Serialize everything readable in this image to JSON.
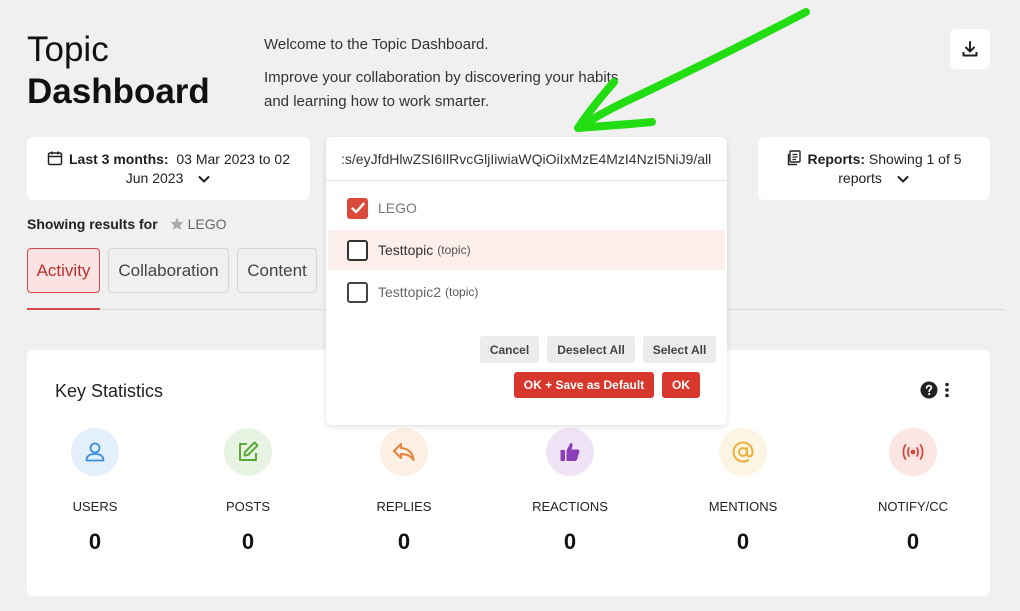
{
  "header": {
    "title_line1": "Topic",
    "title_line2": "Dashboard",
    "welcome_line1": "Welcome to the Topic Dashboard.",
    "welcome_line2": "Improve your collaboration by discovering your habits and learning how to work smarter."
  },
  "date_filter": {
    "label": "Last 3 months:",
    "range": "03 Mar 2023 to 02 Jun 2023"
  },
  "reports_filter": {
    "label": "Reports:",
    "value": "Showing 1 of 5 reports"
  },
  "topic_dropdown": {
    "search_value": ":s/eyJfdHlwZSI6IlRvcGljIiwiaWQiOiIxMzE4MzI4NzI5NiJ9/all",
    "options": [
      {
        "label": "LEGO",
        "type": "",
        "checked": true
      },
      {
        "label": "Testtopic",
        "type": "(topic)",
        "checked": false
      },
      {
        "label": "Testtopic2",
        "type": "(topic)",
        "checked": false
      }
    ],
    "cancel_label": "Cancel",
    "deselect_all_label": "Deselect All",
    "select_all_label": "Select All",
    "ok_save_default_label": "OK + Save as Default",
    "ok_label": "OK"
  },
  "showing_results": {
    "label": "Showing results for",
    "topic": "LEGO"
  },
  "tabs": [
    {
      "label": "Activity",
      "active": true
    },
    {
      "label": "Collaboration",
      "active": false
    },
    {
      "label": "Content",
      "active": false
    }
  ],
  "key_statistics": {
    "title": "Key Statistics",
    "items": [
      {
        "label": "USERS",
        "value": "0",
        "icon": "user-icon",
        "color": "#3b8fd9",
        "bg": "#e3f0fb"
      },
      {
        "label": "POSTS",
        "value": "0",
        "icon": "edit-icon",
        "color": "#5aa83a",
        "bg": "#e8f4e2"
      },
      {
        "label": "REPLIES",
        "value": "0",
        "icon": "reply-icon",
        "color": "#e8833a",
        "bg": "#fcefe3"
      },
      {
        "label": "REACTIONS",
        "value": "0",
        "icon": "thumbs-up-icon",
        "color": "#8a3fb8",
        "bg": "#efe3f6"
      },
      {
        "label": "MENTIONS",
        "value": "0",
        "icon": "at-icon",
        "color": "#e8b23a",
        "bg": "#fcf5e3"
      },
      {
        "label": "NOTIFY/CC",
        "value": "0",
        "icon": "broadcast-icon",
        "color": "#d9473b",
        "bg": "#fbe6e4"
      }
    ]
  },
  "colors": {
    "accent_red": "#d8372b",
    "annotation_arrow": "#22dd11"
  }
}
